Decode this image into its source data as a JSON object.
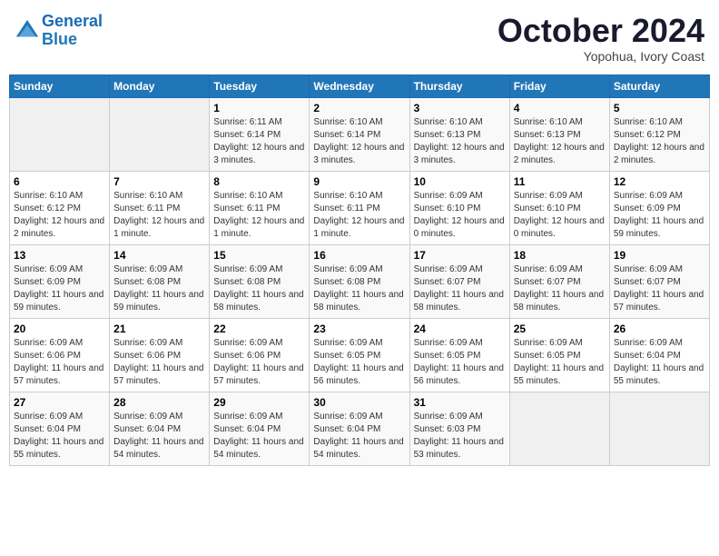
{
  "header": {
    "logo_line1": "General",
    "logo_line2": "Blue",
    "month": "October 2024",
    "location": "Yopohua, Ivory Coast"
  },
  "weekdays": [
    "Sunday",
    "Monday",
    "Tuesday",
    "Wednesday",
    "Thursday",
    "Friday",
    "Saturday"
  ],
  "weeks": [
    [
      {
        "day": "",
        "info": ""
      },
      {
        "day": "",
        "info": ""
      },
      {
        "day": "1",
        "info": "Sunrise: 6:11 AM\nSunset: 6:14 PM\nDaylight: 12 hours and 3 minutes."
      },
      {
        "day": "2",
        "info": "Sunrise: 6:10 AM\nSunset: 6:14 PM\nDaylight: 12 hours and 3 minutes."
      },
      {
        "day": "3",
        "info": "Sunrise: 6:10 AM\nSunset: 6:13 PM\nDaylight: 12 hours and 3 minutes."
      },
      {
        "day": "4",
        "info": "Sunrise: 6:10 AM\nSunset: 6:13 PM\nDaylight: 12 hours and 2 minutes."
      },
      {
        "day": "5",
        "info": "Sunrise: 6:10 AM\nSunset: 6:12 PM\nDaylight: 12 hours and 2 minutes."
      }
    ],
    [
      {
        "day": "6",
        "info": "Sunrise: 6:10 AM\nSunset: 6:12 PM\nDaylight: 12 hours and 2 minutes."
      },
      {
        "day": "7",
        "info": "Sunrise: 6:10 AM\nSunset: 6:11 PM\nDaylight: 12 hours and 1 minute."
      },
      {
        "day": "8",
        "info": "Sunrise: 6:10 AM\nSunset: 6:11 PM\nDaylight: 12 hours and 1 minute."
      },
      {
        "day": "9",
        "info": "Sunrise: 6:10 AM\nSunset: 6:11 PM\nDaylight: 12 hours and 1 minute."
      },
      {
        "day": "10",
        "info": "Sunrise: 6:09 AM\nSunset: 6:10 PM\nDaylight: 12 hours and 0 minutes."
      },
      {
        "day": "11",
        "info": "Sunrise: 6:09 AM\nSunset: 6:10 PM\nDaylight: 12 hours and 0 minutes."
      },
      {
        "day": "12",
        "info": "Sunrise: 6:09 AM\nSunset: 6:09 PM\nDaylight: 11 hours and 59 minutes."
      }
    ],
    [
      {
        "day": "13",
        "info": "Sunrise: 6:09 AM\nSunset: 6:09 PM\nDaylight: 11 hours and 59 minutes."
      },
      {
        "day": "14",
        "info": "Sunrise: 6:09 AM\nSunset: 6:08 PM\nDaylight: 11 hours and 59 minutes."
      },
      {
        "day": "15",
        "info": "Sunrise: 6:09 AM\nSunset: 6:08 PM\nDaylight: 11 hours and 58 minutes."
      },
      {
        "day": "16",
        "info": "Sunrise: 6:09 AM\nSunset: 6:08 PM\nDaylight: 11 hours and 58 minutes."
      },
      {
        "day": "17",
        "info": "Sunrise: 6:09 AM\nSunset: 6:07 PM\nDaylight: 11 hours and 58 minutes."
      },
      {
        "day": "18",
        "info": "Sunrise: 6:09 AM\nSunset: 6:07 PM\nDaylight: 11 hours and 58 minutes."
      },
      {
        "day": "19",
        "info": "Sunrise: 6:09 AM\nSunset: 6:07 PM\nDaylight: 11 hours and 57 minutes."
      }
    ],
    [
      {
        "day": "20",
        "info": "Sunrise: 6:09 AM\nSunset: 6:06 PM\nDaylight: 11 hours and 57 minutes."
      },
      {
        "day": "21",
        "info": "Sunrise: 6:09 AM\nSunset: 6:06 PM\nDaylight: 11 hours and 57 minutes."
      },
      {
        "day": "22",
        "info": "Sunrise: 6:09 AM\nSunset: 6:06 PM\nDaylight: 11 hours and 57 minutes."
      },
      {
        "day": "23",
        "info": "Sunrise: 6:09 AM\nSunset: 6:05 PM\nDaylight: 11 hours and 56 minutes."
      },
      {
        "day": "24",
        "info": "Sunrise: 6:09 AM\nSunset: 6:05 PM\nDaylight: 11 hours and 56 minutes."
      },
      {
        "day": "25",
        "info": "Sunrise: 6:09 AM\nSunset: 6:05 PM\nDaylight: 11 hours and 55 minutes."
      },
      {
        "day": "26",
        "info": "Sunrise: 6:09 AM\nSunset: 6:04 PM\nDaylight: 11 hours and 55 minutes."
      }
    ],
    [
      {
        "day": "27",
        "info": "Sunrise: 6:09 AM\nSunset: 6:04 PM\nDaylight: 11 hours and 55 minutes."
      },
      {
        "day": "28",
        "info": "Sunrise: 6:09 AM\nSunset: 6:04 PM\nDaylight: 11 hours and 54 minutes."
      },
      {
        "day": "29",
        "info": "Sunrise: 6:09 AM\nSunset: 6:04 PM\nDaylight: 11 hours and 54 minutes."
      },
      {
        "day": "30",
        "info": "Sunrise: 6:09 AM\nSunset: 6:04 PM\nDaylight: 11 hours and 54 minutes."
      },
      {
        "day": "31",
        "info": "Sunrise: 6:09 AM\nSunset: 6:03 PM\nDaylight: 11 hours and 53 minutes."
      },
      {
        "day": "",
        "info": ""
      },
      {
        "day": "",
        "info": ""
      }
    ]
  ]
}
